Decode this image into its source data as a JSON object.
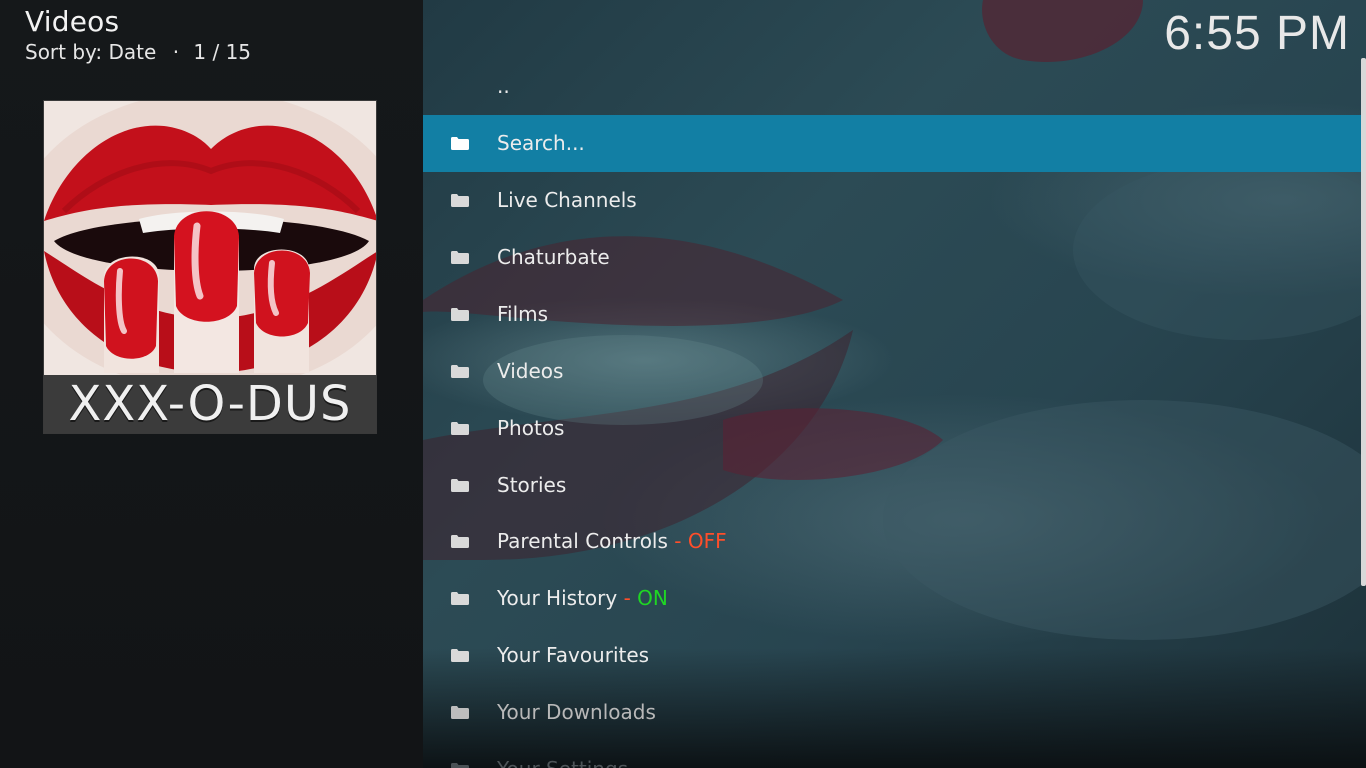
{
  "header": {
    "window_title": "Videos",
    "sort_label": "Sort by: Date",
    "separator": "·",
    "position": "1 / 15"
  },
  "clock": "6:55 PM",
  "thumbnail": {
    "caption": "XXX-O-DUS"
  },
  "list": {
    "parent": "..",
    "items": [
      {
        "label": "Search...",
        "selected": true
      },
      {
        "label": "Live Channels"
      },
      {
        "label": "Chaturbate"
      },
      {
        "label": "Films"
      },
      {
        "label": "Videos"
      },
      {
        "label": "Photos"
      },
      {
        "label": "Stories"
      },
      {
        "label": "Parental Controls",
        "sep": "-",
        "value": "OFF"
      },
      {
        "label": "Your History",
        "sep": "-",
        "value": "ON"
      },
      {
        "label": "Your Favourites"
      },
      {
        "label": "Your Downloads"
      },
      {
        "label": "Your Settings"
      }
    ]
  },
  "colors": {
    "selection": "#127fa4",
    "off": "#ff4e2a",
    "on": "#1fd624"
  },
  "icons": {
    "list_item": "folder-icon"
  }
}
